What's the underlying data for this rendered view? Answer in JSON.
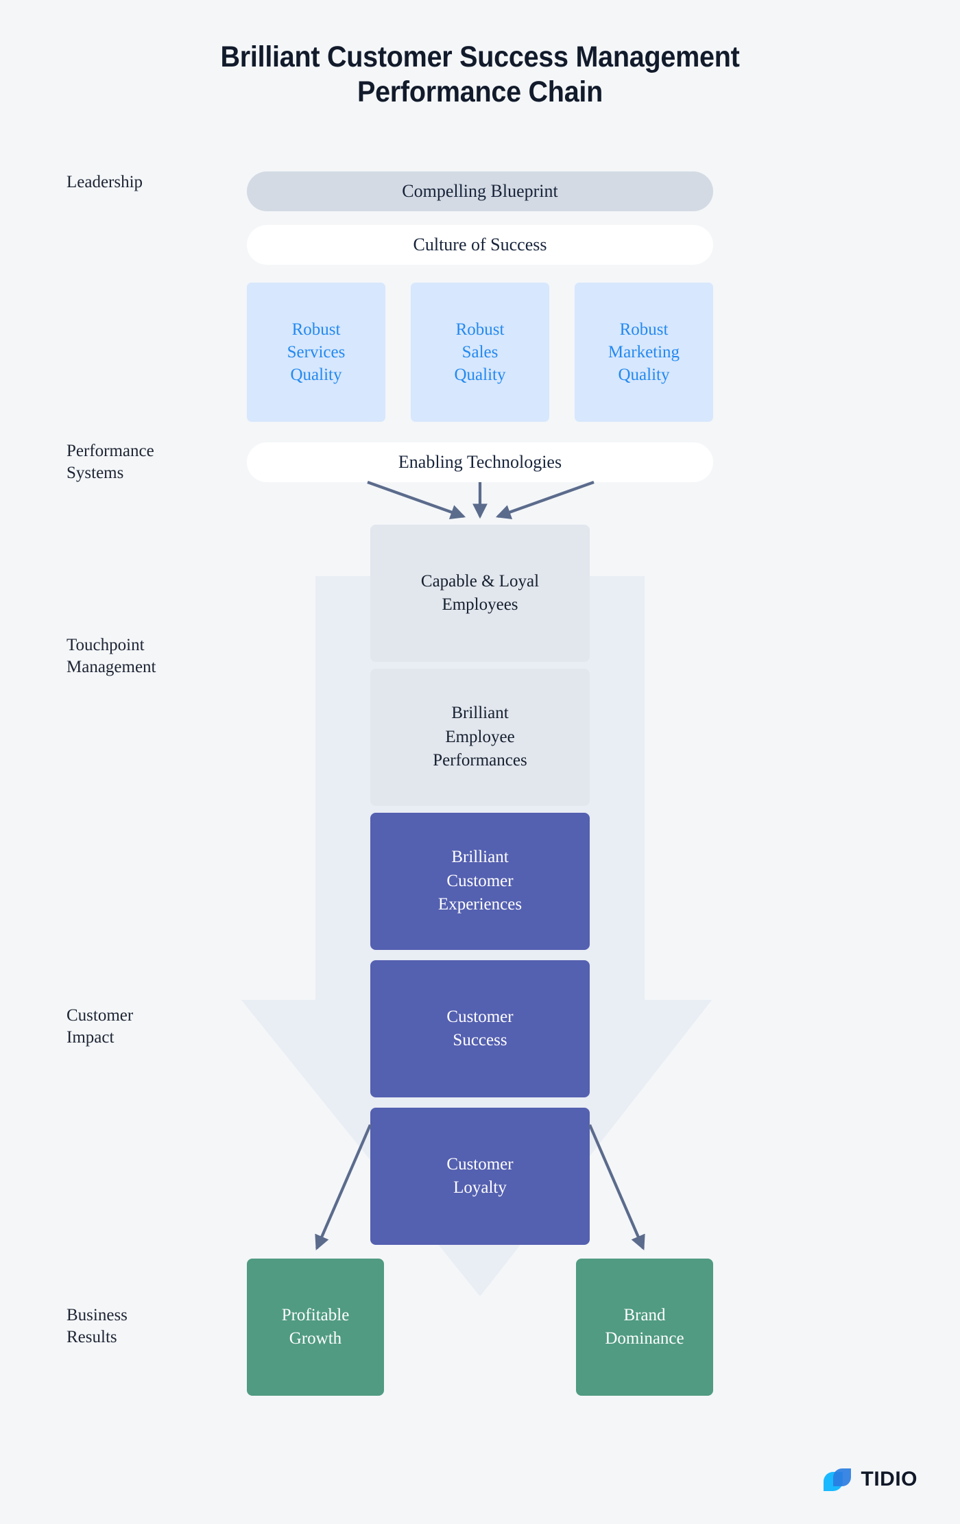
{
  "title": {
    "line1": "Brilliant Customer Success Management",
    "line2": "Performance Chain"
  },
  "stages": [
    {
      "id": "leadership",
      "line1": "Leadership",
      "line2": ""
    },
    {
      "id": "performance",
      "line1": "Performance",
      "line2": "Systems"
    },
    {
      "id": "touchpoint",
      "line1": "Touchpoint",
      "line2": "Management"
    },
    {
      "id": "customer",
      "line1": "Customer",
      "line2": "Impact"
    },
    {
      "id": "business",
      "line1": "Business",
      "line2": "Results"
    }
  ],
  "pills": [
    {
      "id": "compelling-blueprint",
      "label": "Compelling Blueprint",
      "style": "grey"
    },
    {
      "id": "culture-of-success",
      "label": "Culture of Success",
      "style": "white"
    },
    {
      "id": "enabling-technologies",
      "label": "Enabling Technologies",
      "style": "white"
    }
  ],
  "quality_boxes": [
    {
      "id": "robust-services-quality",
      "l1": "Robust",
      "l2": "Services",
      "l3": "Quality"
    },
    {
      "id": "robust-sales-quality",
      "l1": "Robust",
      "l2": "Sales",
      "l3": "Quality"
    },
    {
      "id": "robust-marketing-quality",
      "l1": "Robust",
      "l2": "Marketing",
      "l3": "Quality"
    }
  ],
  "chain_boxes": [
    {
      "id": "capable-loyal-employees",
      "l1": "Capable & Loyal",
      "l2": "Employees",
      "l3": "",
      "style": "grey"
    },
    {
      "id": "brilliant-employee-performances",
      "l1": "Brilliant",
      "l2": "Employee",
      "l3": "Performances",
      "style": "grey"
    },
    {
      "id": "brilliant-customer-experiences",
      "l1": "Brilliant",
      "l2": "Customer",
      "l3": "Experiences",
      "style": "purple"
    },
    {
      "id": "customer-success",
      "l1": "Customer",
      "l2": "Success",
      "l3": "",
      "style": "purple"
    },
    {
      "id": "customer-loyalty",
      "l1": "Customer",
      "l2": "Loyalty",
      "l3": "",
      "style": "purple"
    }
  ],
  "result_boxes": [
    {
      "id": "profitable-growth",
      "l1": "Profitable",
      "l2": "Growth"
    },
    {
      "id": "brand-dominance",
      "l1": "Brand",
      "l2": "Dominance"
    }
  ],
  "logo": {
    "text": "TIDIO"
  },
  "colors": {
    "background": "#f4f6f8",
    "title_text": "#121b2b",
    "pill_grey": "#d3dae3",
    "pill_white": "#ffffff",
    "quality_fill": "#d7e7fd",
    "quality_text": "#2389f0",
    "chain_grey_fill": "#e2e6ed",
    "chain_purple_fill": "#5460b0",
    "result_fill": "#509b81",
    "arrow_stroke": "#5b6b8c",
    "background_arrow": "#e9edf4"
  }
}
